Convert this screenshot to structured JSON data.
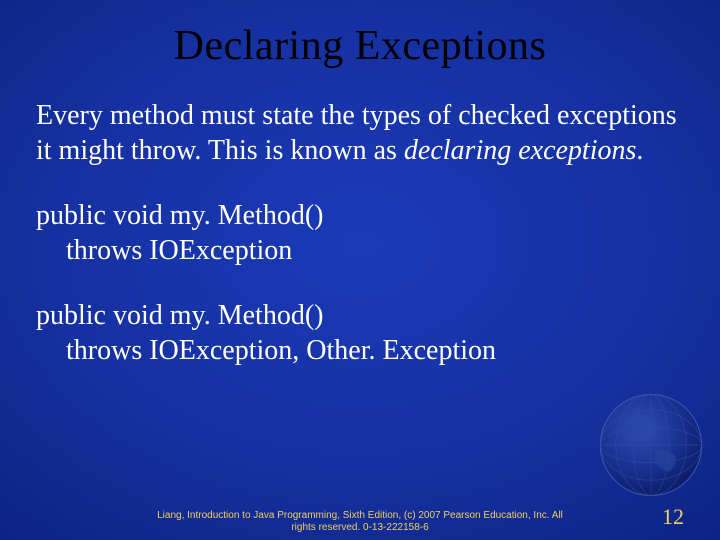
{
  "title": "Declaring Exceptions",
  "body": {
    "para_part1": "Every method must state the types of checked exceptions it might throw. This is known as ",
    "para_italic": "declaring exceptions",
    "para_part2": "."
  },
  "code1": {
    "line1": "public void my. Method()",
    "line2": "throws IOException"
  },
  "code2": {
    "line1": "public void my. Method()",
    "line2": "throws IOException, Other. Exception"
  },
  "footer": {
    "line1": "Liang, Introduction to Java Programming, Sixth Edition, (c) 2007 Pearson Education, Inc. All",
    "line2": "rights reserved. 0-13-222158-6"
  },
  "page_number": "12"
}
